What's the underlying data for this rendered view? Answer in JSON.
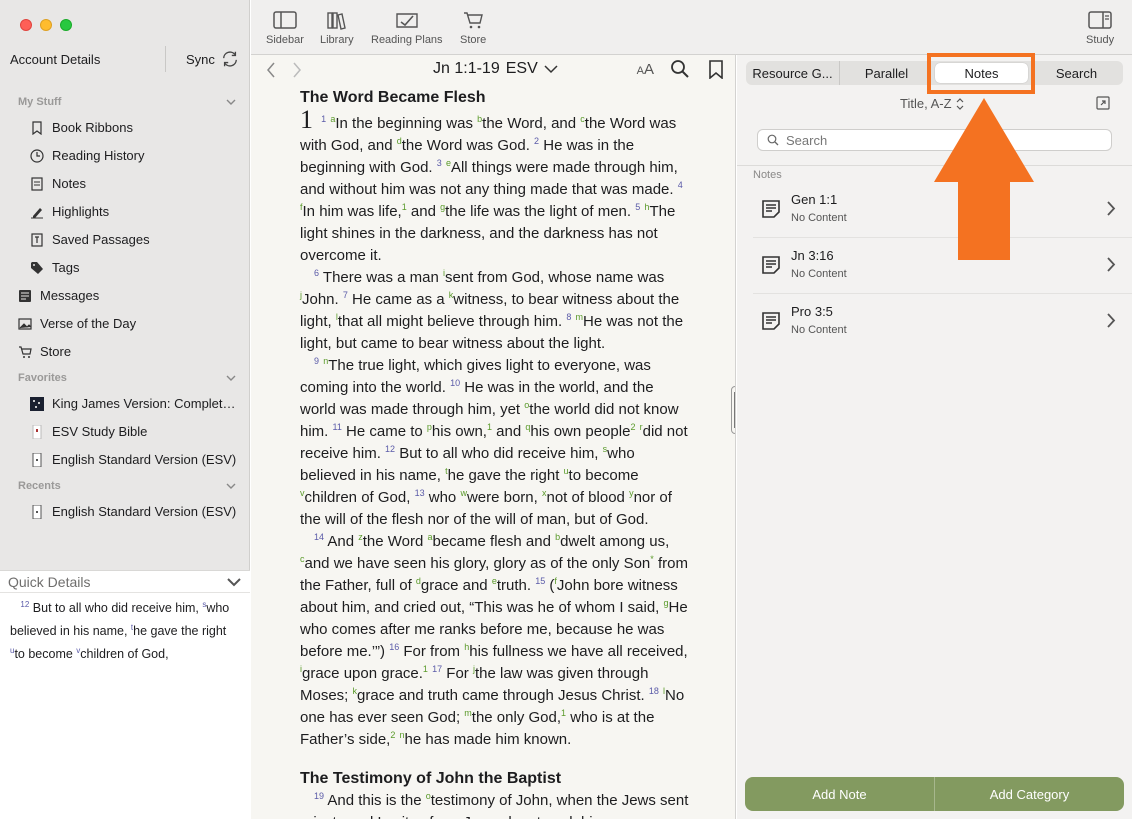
{
  "sidebar": {
    "account_label": "Account Details",
    "sync_label": "Sync",
    "sections": {
      "my_stuff": "My Stuff",
      "favorites": "Favorites",
      "recents": "Recents"
    },
    "my_stuff_items": [
      {
        "label": "Book Ribbons",
        "icon": "bookmark-icon"
      },
      {
        "label": "Reading History",
        "icon": "clock-icon"
      },
      {
        "label": "Notes",
        "icon": "note-icon"
      },
      {
        "label": "Highlights",
        "icon": "highlighter-icon"
      },
      {
        "label": "Saved Passages",
        "icon": "saved-passage-icon"
      },
      {
        "label": "Tags",
        "icon": "tag-icon"
      }
    ],
    "top_items": [
      {
        "label": "Messages",
        "icon": "messages-icon"
      },
      {
        "label": "Verse of the Day",
        "icon": "image-icon"
      },
      {
        "label": "Store",
        "icon": "cart-icon"
      }
    ],
    "favorites_items": [
      {
        "label": "King James Version: Complet…",
        "icon": "book-cover-icon"
      },
      {
        "label": "ESV Study Bible",
        "icon": "book-cover-icon"
      },
      {
        "label": "English Standard Version (ESV)",
        "icon": "book-cover-icon"
      }
    ],
    "recents_items": [
      {
        "label": "English Standard Version (ESV)",
        "icon": "book-cover-icon"
      }
    ],
    "quick_details": {
      "title": "Quick Details"
    }
  },
  "toolbar": {
    "sidebar": "Sidebar",
    "library": "Library",
    "reading_plans": "Reading Plans",
    "store": "Store",
    "study": "Study"
  },
  "reader": {
    "reference": "Jn 1:1-19",
    "version": "ESV",
    "font_size_label": "AA",
    "heading1": "The Word Became Flesh",
    "heading2": "The Testimony of John the Baptist"
  },
  "panel": {
    "tabs": [
      "Resource G...",
      "Parallel",
      "Notes",
      "Search"
    ],
    "active_tab": "Notes",
    "sort_label": "Title, A-Z",
    "search_placeholder": "Search",
    "section_label": "Notes",
    "notes": [
      {
        "title": "Gen 1:1",
        "subtitle": "No Content"
      },
      {
        "title": "Jn 3:16",
        "subtitle": "No Content"
      },
      {
        "title": "Pro 3:5",
        "subtitle": "No Content"
      }
    ],
    "add_note": "Add Note",
    "add_category": "Add Category"
  },
  "colors": {
    "highlight": "#f47221",
    "action_button": "#839a60",
    "verse_number": "#5a5aa8",
    "footnote": "#5a9a2a"
  }
}
